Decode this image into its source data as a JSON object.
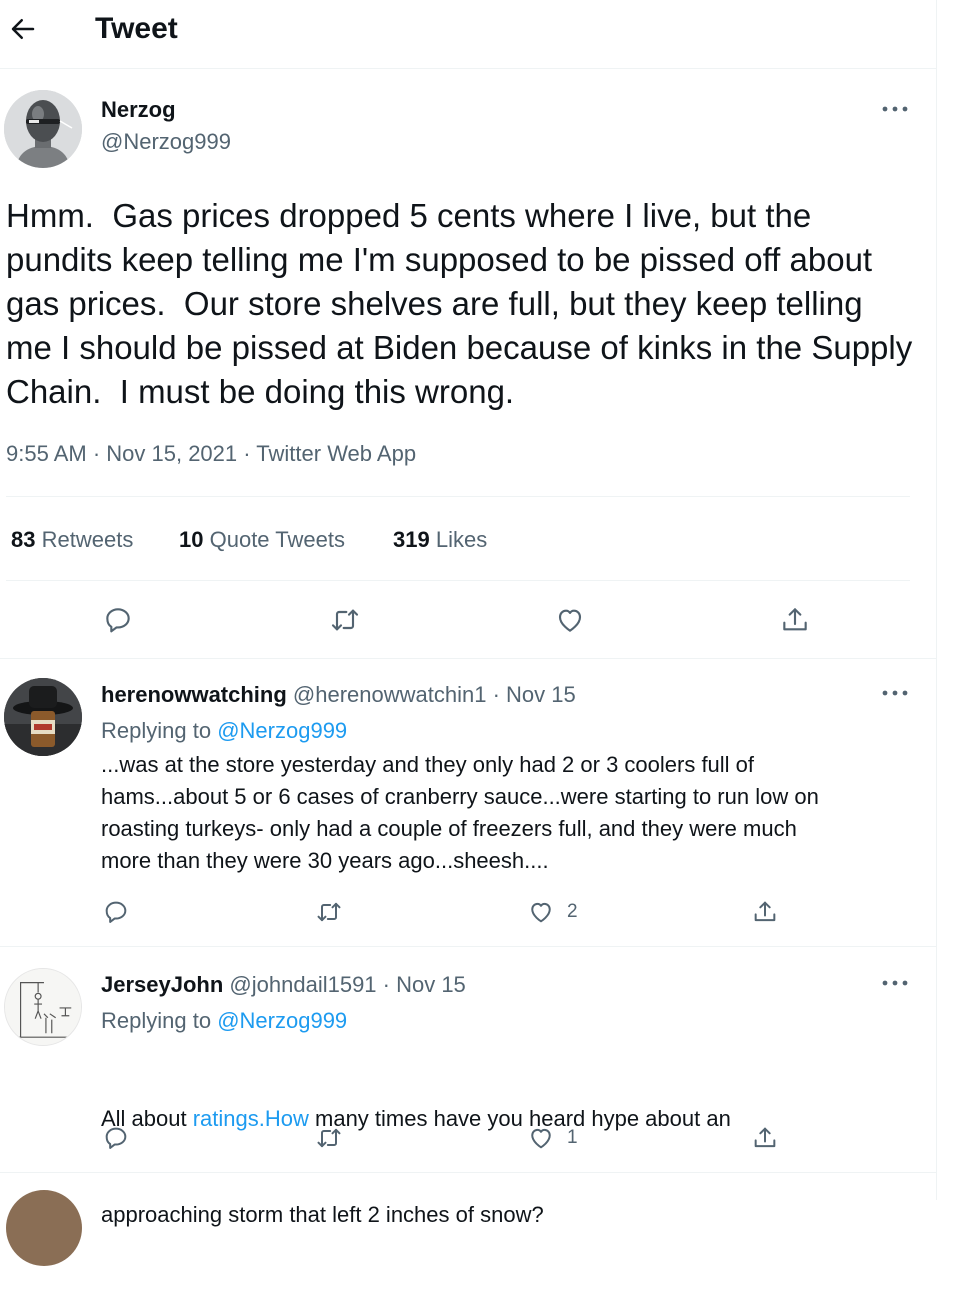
{
  "header": {
    "title": "Tweet",
    "back_icon": "arrow-left-icon"
  },
  "main_tweet": {
    "display_name": "Nerzog",
    "handle": "@Nerzog999",
    "text": "Hmm.  Gas prices dropped 5 cents where I live, but the pundits keep telling me I'm supposed to be pissed off about gas prices.  Our store shelves are full, but they keep telling me I should be pissed at Biden because of kinks in the Supply Chain.  I must be doing this wrong.",
    "meta": "9:55 AM · Nov 15, 2021 · Twitter Web App",
    "stats": {
      "retweets_count": "83",
      "retweets_label": "Retweets",
      "quotes_count": "10",
      "quotes_label": "Quote Tweets",
      "likes_count": "319",
      "likes_label": "Likes"
    }
  },
  "replies": [
    {
      "display_name": "herenowwatching",
      "handle_date": "@herenowwatchin1 · Nov 15",
      "replying_prefix": "Replying to",
      "replying_handle": "@Nerzog999",
      "lines": [
        "...was at the store yesterday and they only had 2 or 3 coolers full of",
        "hams...about 5 or 6 cases of cranberry sauce...were starting to run low on",
        "roasting turkeys- only had a couple of freezers full, and they were much",
        "more than they were 30 years ago...sheesh...."
      ],
      "like_count": "2"
    },
    {
      "display_name": "JerseyJohn",
      "handle_date": "@johndail1591 · Nov 15",
      "replying_prefix": "Replying to",
      "replying_handle": "@Nerzog999",
      "line1_pre": "All about ",
      "line1_link": "ratings.How",
      "line1_post": " many times have you heard hype about an",
      "line2": "approaching storm that left 2 inches of snow?",
      "like_count": "1"
    }
  ],
  "colors": {
    "text": "#0f1419",
    "muted": "#536471",
    "link": "#1d9bf0",
    "divider": "#eff3f4"
  }
}
